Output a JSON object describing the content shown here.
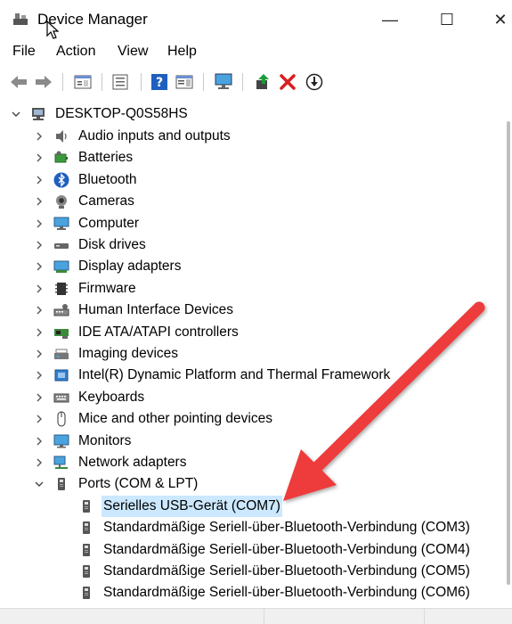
{
  "window": {
    "title": "Device Manager",
    "controls": {
      "minimize": "—",
      "maximize": "☐",
      "close": "✕"
    }
  },
  "menu": [
    "File",
    "Action",
    "View",
    "Help"
  ],
  "toolbar": {
    "icons": [
      "back-icon",
      "forward-icon",
      "properties-icon",
      "console-tree-icon",
      "help-icon",
      "action-pane-icon",
      "monitor-icon",
      "update-driver-icon",
      "uninstall-icon",
      "disable-device-icon"
    ],
    "accent_red": "#d81e1e",
    "accent_blue": "#1f5fbf",
    "accent_green": "#1d9b3a"
  },
  "tree": {
    "root": "DESKTOP-Q0S58HS",
    "categories": [
      {
        "label": "Audio inputs and outputs",
        "icon": "speaker-icon"
      },
      {
        "label": "Batteries",
        "icon": "battery-icon"
      },
      {
        "label": "Bluetooth",
        "icon": "bluetooth-icon"
      },
      {
        "label": "Cameras",
        "icon": "camera-icon"
      },
      {
        "label": "Computer",
        "icon": "computer-icon"
      },
      {
        "label": "Disk drives",
        "icon": "disk-drive-icon"
      },
      {
        "label": "Display adapters",
        "icon": "display-adapter-icon"
      },
      {
        "label": "Firmware",
        "icon": "firmware-icon"
      },
      {
        "label": "Human Interface Devices",
        "icon": "hid-icon"
      },
      {
        "label": "IDE ATA/ATAPI controllers",
        "icon": "ide-controller-icon"
      },
      {
        "label": "Imaging devices",
        "icon": "imaging-icon"
      },
      {
        "label": "Intel(R) Dynamic Platform and Thermal Framework",
        "icon": "thermal-icon"
      },
      {
        "label": "Keyboards",
        "icon": "keyboard-icon"
      },
      {
        "label": "Mice and other pointing devices",
        "icon": "mouse-icon"
      },
      {
        "label": "Monitors",
        "icon": "monitor-icon"
      },
      {
        "label": "Network adapters",
        "icon": "network-adapter-icon"
      },
      {
        "label": "Ports (COM & LPT)",
        "icon": "port-icon",
        "expanded": true
      }
    ],
    "ports": [
      {
        "label": "Serielles USB-Gerät (COM7)",
        "selected": true
      },
      {
        "label": "Standardmäßige Seriell-über-Bluetooth-Verbindung (COM3)"
      },
      {
        "label": "Standardmäßige Seriell-über-Bluetooth-Verbindung (COM4)"
      },
      {
        "label": "Standardmäßige Seriell-über-Bluetooth-Verbindung (COM5)"
      },
      {
        "label": "Standardmäßige Seriell-über-Bluetooth-Verbindung (COM6)"
      }
    ],
    "selection_color": "#cce8ff"
  },
  "annotation": {
    "arrow_color": "#ee3a3a"
  }
}
